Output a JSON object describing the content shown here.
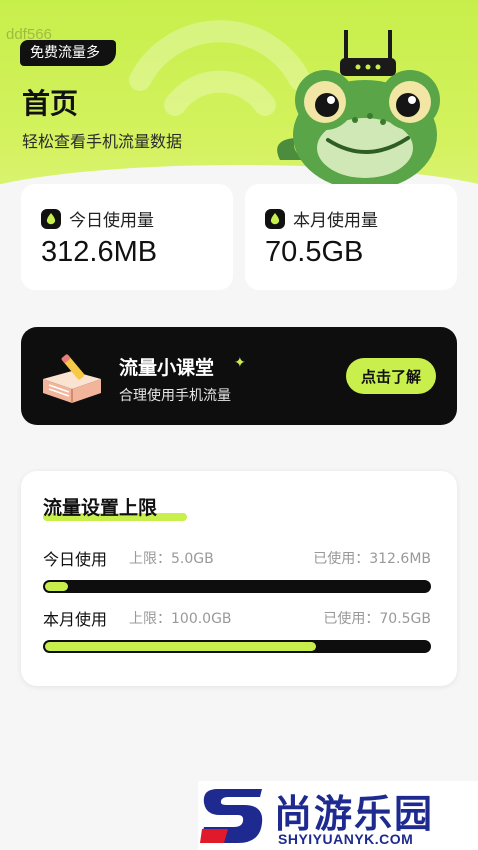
{
  "header": {
    "watermark_id": "ddf566",
    "badge": "免费流量多",
    "title": "首页",
    "subtitle": "轻松查看手机流量数据"
  },
  "stats": [
    {
      "label": "今日使用量",
      "value": "312.6MB"
    },
    {
      "label": "本月使用量",
      "value": "70.5GB"
    }
  ],
  "lesson": {
    "title": "流量小课堂",
    "sparkle": "✦",
    "subtitle": "合理使用手机流量",
    "button": "点击了解"
  },
  "limits": {
    "title": "流量设置上限",
    "rows": [
      {
        "name": "今日使用",
        "limit": "上限：5.0GB",
        "used": "已使用：312.6MB",
        "progress": 0.06
      },
      {
        "name": "本月使用",
        "limit": "上限：100.0GB",
        "used": "已使用：70.5GB",
        "progress": 0.705
      }
    ]
  },
  "watermark": {
    "name": "尚游乐园",
    "url": "SHYIYUANYK.COM"
  },
  "colors": {
    "accent": "#c8ef4b",
    "dark": "#0e0e0e",
    "brand": "#1e2a8f"
  }
}
